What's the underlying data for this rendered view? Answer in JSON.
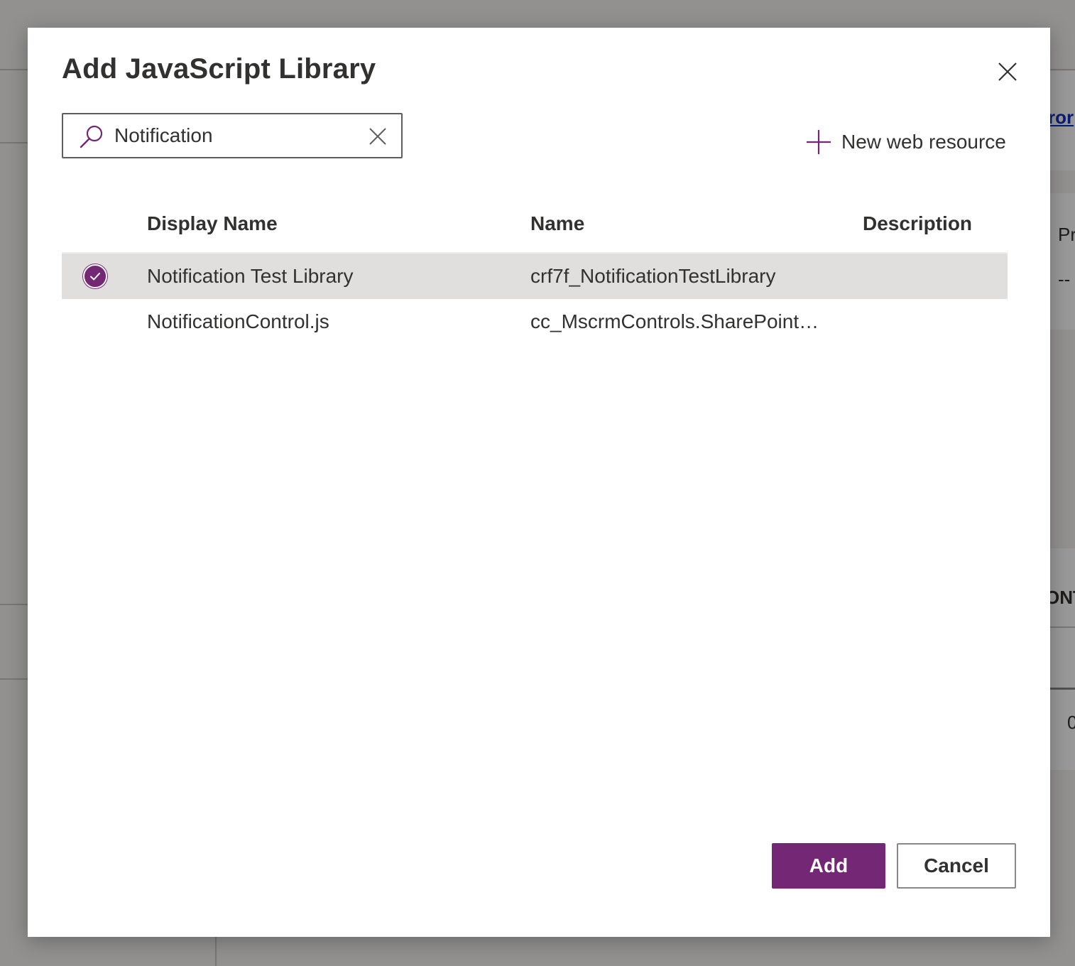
{
  "background": {
    "link_fragment": "ror",
    "label_fragment": "Pr",
    "dash_fragment": "--",
    "caps_fragment": "ONT",
    "digit_fragment": "0"
  },
  "dialog": {
    "title": "Add JavaScript Library",
    "close_icon": "close-icon"
  },
  "search": {
    "value": "Notification",
    "icon": "search-icon",
    "clear_icon": "clear-icon"
  },
  "toolbar": {
    "new_resource_label": "New web resource",
    "new_resource_icon": "plus-icon"
  },
  "table": {
    "columns": [
      "Display Name",
      "Name",
      "Description"
    ],
    "rows": [
      {
        "display_name": "Notification Test Library",
        "name": "crf7f_NotificationTestLibrary",
        "description": "",
        "selected": true
      },
      {
        "display_name": "NotificationControl.js",
        "name": "cc_MscrmControls.SharePointControl",
        "description": "",
        "selected": false
      }
    ]
  },
  "footer": {
    "add_label": "Add",
    "cancel_label": "Cancel"
  },
  "colors": {
    "accent": "#742774",
    "selected_row": "#e1dfdd",
    "border": "#605e5c"
  }
}
